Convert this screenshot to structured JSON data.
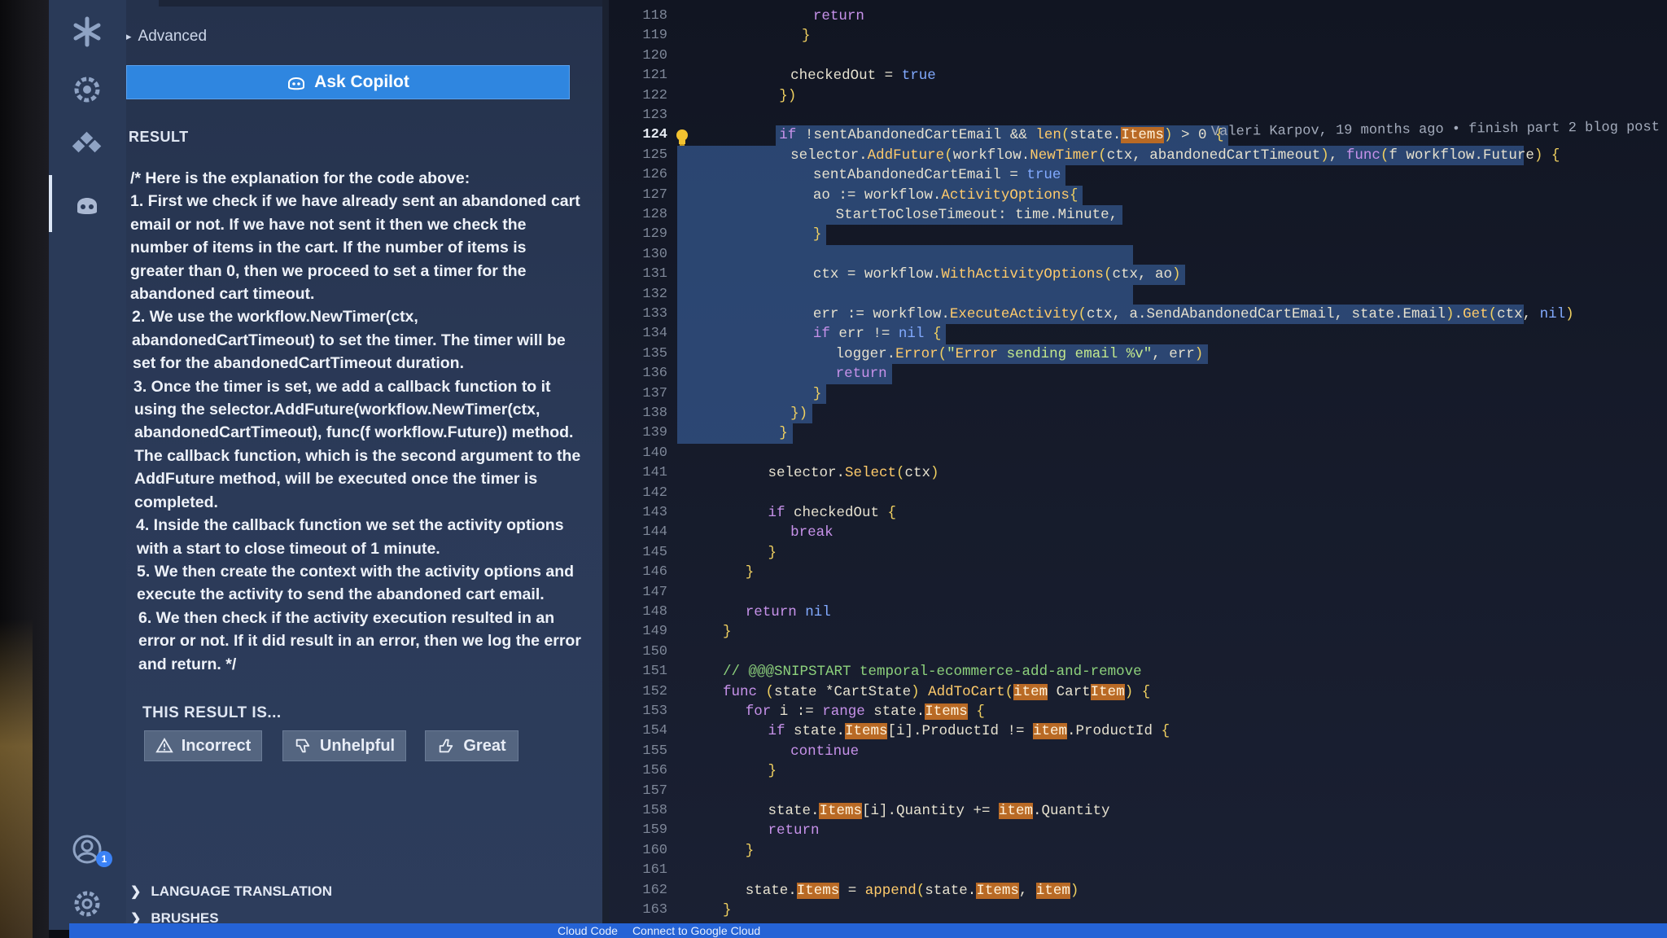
{
  "colors": {
    "accent": "#2f86e0",
    "status_bar": "#2563d6",
    "selection": "#3a62a0",
    "match_highlight": "#b96a25"
  },
  "activity_bar": {
    "icons": [
      "asterisk-icon",
      "gear-icon",
      "extensions-icon",
      "copilot-icon",
      "account-icon",
      "settings-icon"
    ],
    "account_badge": "1"
  },
  "side_panel": {
    "advanced_label": "Advanced",
    "ask_button_label": "Ask Copilot",
    "result_heading": "RESULT",
    "result_lines": [
      "/* Here is the explanation for the code above:",
      "1. First we check if we have already sent an abandoned cart",
      "email or not. If we have not sent it then we check the",
      "number of items in the cart. If the number of items is",
      "greater than 0, then we proceed to set a timer for the",
      "abandoned cart timeout.",
      "2. We use the workflow.NewTimer(ctx,",
      "abandonedCartTimeout) to set the timer. The timer will be",
      "set for the abandonedCartTimeout duration.",
      "3. Once the timer is set, we add a callback function to it",
      "using the selector.AddFuture(workflow.NewTimer(ctx,",
      "abandonedCartTimeout), func(f workflow.Future)) method.",
      "The callback function, which is the second argument to the",
      "AddFuture method, will be executed once the timer is",
      "completed.",
      "4. Inside the callback function we set the activity options",
      "with a start to close timeout of 1 minute.",
      "5. We then create the context with the activity options and",
      "execute the activity to send the abandoned cart email.",
      "6. We then check if the activity execution resulted in an",
      "error or not. If it did result in an error, then we log the error",
      "and return. */"
    ],
    "rating_heading": "THIS RESULT IS...",
    "rating_buttons": {
      "incorrect": "Incorrect",
      "unhelpful": "Unhelpful",
      "great": "Great"
    },
    "sections": {
      "language_translation": "LANGUAGE TRANSLATION",
      "brushes": "BRUSHES"
    }
  },
  "editor": {
    "current_line": 124,
    "line_numbers": [
      "118",
      "119",
      "120",
      "121",
      "122",
      "123",
      "124",
      "125",
      "126",
      "127",
      "128",
      "129",
      "130",
      "131",
      "132",
      "133",
      "134",
      "135",
      "136",
      "137",
      "138",
      "139",
      "140",
      "141",
      "142",
      "143",
      "144",
      "145",
      "146",
      "147",
      "148",
      "149",
      "150",
      "151",
      "152",
      "153",
      "154",
      "155",
      "156",
      "157",
      "158",
      "159",
      "160",
      "161",
      "162",
      "163"
    ],
    "code_lines": [
      "return",
      "}",
      "",
      "checkedOut = true",
      "})",
      "",
      "if !sentAbandonedCartEmail && len(state.Items) > 0 {",
      "selector.AddFuture(workflow.NewTimer(ctx, abandonedCartTimeout), func(f workflow.Future) {",
      "sentAbandonedCartEmail = true",
      "ao := workflow.ActivityOptions{",
      "StartToCloseTimeout: time.Minute,",
      "}",
      "",
      "ctx = workflow.WithActivityOptions(ctx, ao)",
      "",
      "err := workflow.ExecuteActivity(ctx, a.SendAbandonedCartEmail, state.Email).Get(ctx, nil)",
      "if err != nil {",
      "logger.Error(\"Error sending email %v\", err)",
      "return",
      "}",
      "})",
      "}",
      "",
      "selector.Select(ctx)",
      "",
      "if checkedOut {",
      "break",
      "}",
      "}",
      "",
      "return nil",
      "}",
      "",
      "// @@@SNIPSTART temporal-ecommerce-add-and-remove",
      "func (state *CartState) AddToCart(item CartItem) {",
      "for i := range state.Items {",
      "if state.Items[i].ProductId != item.ProductId {",
      "continue",
      "}",
      "",
      "state.Items[i].Quantity += item.Quantity",
      "return",
      "}",
      "",
      "state.Items = append(state.Items, item)",
      "}"
    ],
    "blame_annotation": "Valeri Karpov, 19 months ago • finish part 2 blog post"
  },
  "status_bar": {
    "items": [
      "Cloud Code",
      "Connect to Google Cloud"
    ]
  }
}
